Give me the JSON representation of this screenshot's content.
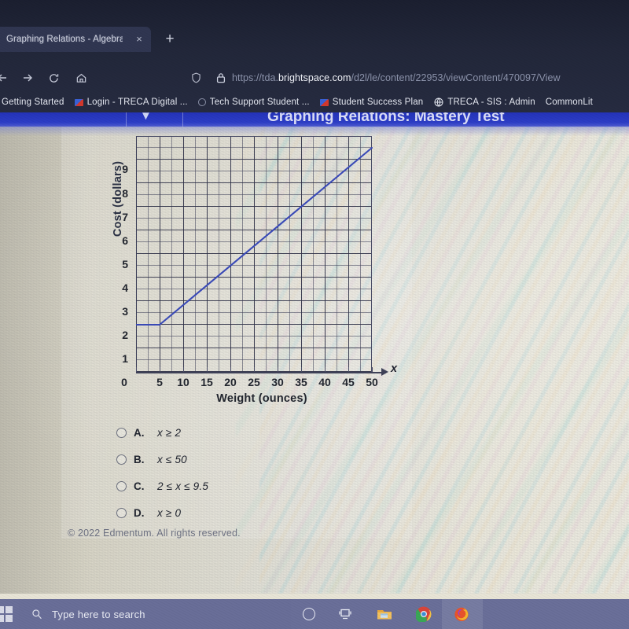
{
  "browser": {
    "tab": {
      "title": "Graphing Relations - Algebra",
      "close_label": "×"
    },
    "new_tab_label": "+",
    "nav": {
      "back_name": "back-button",
      "forward_name": "forward-button",
      "reload_name": "reload-button",
      "home_name": "home-button"
    },
    "omnibox": {
      "url_prefix": "https://tda.",
      "url_host": "brightspace.com",
      "url_path": "/d2l/le/content/22953/viewContent/470097/View",
      "shield_icon": "shield-icon",
      "lock_icon": "lock-icon"
    },
    "bookmarks": [
      {
        "label": "Getting Started",
        "icon": "none"
      },
      {
        "label": "Login - TRECA Digital ...",
        "icon": "sq"
      },
      {
        "label": "Tech Support Student ...",
        "icon": "dot-circle"
      },
      {
        "label": "Student Success Plan",
        "icon": "sq"
      },
      {
        "label": "TRECA - SIS : Admin",
        "icon": "globe"
      },
      {
        "label": "CommonLit",
        "icon": "none"
      }
    ]
  },
  "page": {
    "header_title": "Graphing Relations: Mastery Test",
    "footer": "© 2022 Edmentum. All rights reserved.",
    "choices": [
      {
        "letter": "A.",
        "text": "x ≥ 2"
      },
      {
        "letter": "B.",
        "text": "x ≤ 50"
      },
      {
        "letter": "C.",
        "text": "2 ≤ x ≤ 9.5"
      },
      {
        "letter": "D.",
        "text": "x ≥ 0"
      }
    ]
  },
  "chart_data": {
    "type": "line",
    "title": "",
    "xlabel": "Weight (ounces)",
    "ylabel": "Cost (dollars)",
    "x_axis_variable": "x",
    "xlim": [
      0,
      50
    ],
    "ylim": [
      0,
      9.5
    ],
    "xticks": [
      0,
      5,
      10,
      15,
      20,
      25,
      30,
      35,
      40,
      45,
      50
    ],
    "yticks": [
      1,
      2,
      3,
      4,
      5,
      6,
      7,
      8,
      9
    ],
    "grid": true,
    "grid_minor_step_x": 2.5,
    "grid_minor_step_y": 0.5,
    "line_color": "#3a4ab8",
    "series": [
      {
        "name": "cost",
        "points": [
          [
            0,
            2
          ],
          [
            5,
            2
          ],
          [
            50,
            9.5
          ]
        ]
      }
    ],
    "annotations": [
      "flat segment from x=0 to x=5 at y=2",
      "linear rise from (5,2) to (50,9.5)"
    ]
  },
  "taskbar": {
    "search_placeholder": "Type here to search",
    "start_icon": "windows-start-icon",
    "search_icon": "search-icon",
    "items": [
      {
        "name": "cortana-icon"
      },
      {
        "name": "task-view-icon"
      },
      {
        "name": "file-explorer-icon"
      },
      {
        "name": "chrome-icon"
      },
      {
        "name": "firefox-icon"
      }
    ]
  },
  "colors": {
    "accent_blue": "#2c3dc6",
    "line_blue": "#3a4ab8",
    "taskbar": "#6a6f99",
    "chrome_dark": "#22273a"
  }
}
